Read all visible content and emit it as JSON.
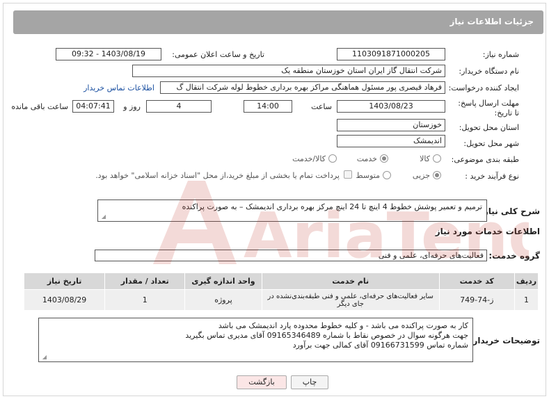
{
  "header": {
    "title": "جزئیات اطلاعات نیاز"
  },
  "fields": {
    "need_number_label": "شماره نیاز:",
    "need_number": "1103091871000205",
    "announce_label": "تاریخ و ساعت اعلان عمومی:",
    "announce_value": "1403/08/19 - 09:32",
    "buyer_org_label": "نام دستگاه خریدار:",
    "buyer_org": "شرکت انتقال گاز ایران  استان خوزستان منطقه یک",
    "requester_label": "ایجاد کننده درخواست:",
    "requester": "فرهاد قیصری پور مسئول هماهنگی مراکز بهره برداری خطوط لوله شرکت انتقال گ",
    "contact_link": "اطلاعات تماس خریدار",
    "deadline_label": "مهلت ارسال پاسخ: تا تاریخ:",
    "deadline_date": "1403/08/23",
    "time_label": "ساعت",
    "deadline_time": "14:00",
    "days_value": "4",
    "days_label": "روز و",
    "remaining_value": "04:07:41",
    "remaining_label": "ساعت باقی مانده",
    "province_label": "استان محل تحویل:",
    "province": "خوزستان",
    "city_label": "شهر محل تحویل:",
    "city": "اندیمشک",
    "category_label": "طبقه بندی موضوعی:",
    "category_options": [
      "کالا",
      "خدمت",
      "کالا/خدمت"
    ],
    "category_selected": "خدمت",
    "process_label": "نوع فرآیند خرید :",
    "process_options": [
      "جزیی",
      "متوسط"
    ],
    "process_selected": "جزیی",
    "payment_note": "پرداخت تمام یا بخشی از مبلغ خرید،از محل \"اسناد خزانه اسلامی\" خواهد بود."
  },
  "summary": {
    "label": "شرح کلی نیاز:",
    "text": "ترمیم و تعمیر پوشش خطوط 4 اینچ تا 24 اینچ مرکز بهره برداری اندیمشک – به صورت پراکنده"
  },
  "services": {
    "section_title": "اطلاعات خدمات مورد نیاز",
    "group_label": "گروه خدمت:",
    "group_value": "فعالیت‌های حرفه‌ای، علمی و فنی",
    "columns": [
      "ردیف",
      "کد خدمت",
      "نام خدمت",
      "واحد اندازه گیری",
      "تعداد / مقدار",
      "تاریخ نیاز"
    ],
    "rows": [
      [
        "1",
        "ز-74-749",
        "سایر فعالیت‌های حرفه‌ای، علمی و فنی طبقه‌بندی‌نشده در جای دیگر",
        "پروژه",
        "1",
        "1403/08/29"
      ]
    ]
  },
  "buyer_notes": {
    "label": "توضیحات خریدار:",
    "lines": [
      "کار به صورت پراکنده می باشد - و کلیه خطوط محدوده پارد اندیمشک می باشد",
      "جهت هرگونه سوال در خصوص نقاط با شماره 09165346489 آقای مدیری تماس بگیرید",
      "شماره تماس 09166731599 آقای کمالی جهت برآورد"
    ]
  },
  "buttons": {
    "print": "چاپ",
    "back": "بازگشت"
  },
  "watermark": {
    "text": "AriaTender.neT"
  },
  "colors": {
    "header_bg": "#a5a5a5",
    "link": "#1a4fa0",
    "back_btn": "#fbe6e6",
    "watermark": "#c0392b"
  }
}
